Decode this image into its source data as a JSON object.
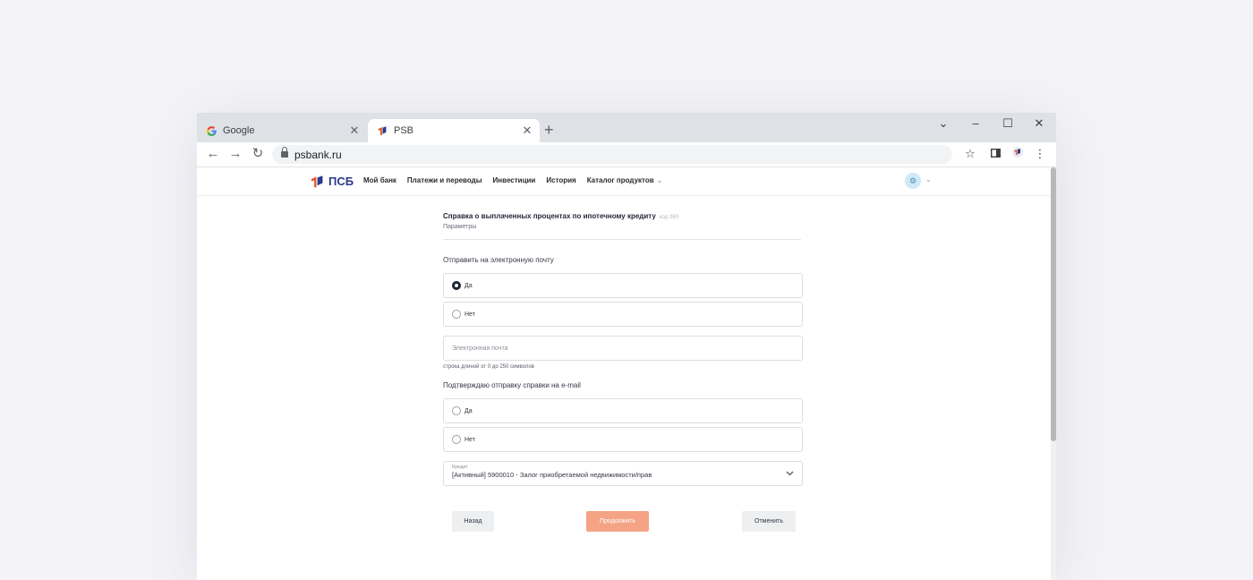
{
  "browser": {
    "tabs": [
      {
        "title": "Google",
        "icon": "google-icon",
        "active": false
      },
      {
        "title": "PSB",
        "icon": "psb-logo-icon",
        "active": true
      }
    ],
    "close_glyph": "✕",
    "new_tab_glyph": "+",
    "url": "psbank.ru",
    "window_controls": {
      "chevron": "⌄",
      "minimize": "–",
      "maximize": "☐",
      "close": "✕"
    },
    "toolbar_icons": {
      "back": "←",
      "forward": "→",
      "reload": "↻",
      "star": "☆",
      "menu": "⋮"
    }
  },
  "site": {
    "logo_text": "ПСБ",
    "nav": [
      "Мой банк",
      "Платежи и переводы",
      "Инвестиции",
      "История",
      "Каталог продуктов"
    ],
    "nav_chevron": "⌄",
    "avatar_glyph": "⚙",
    "accent_color": "#f4a485",
    "brand_color": "#2a3a8c"
  },
  "form": {
    "title": "Справка о выплаченных процентах по ипотечному кредиту",
    "code": "код 360",
    "subtitle": "Параметры",
    "send_email_label": "Отправить на электронную почту",
    "send_email_options": [
      {
        "label": "Да",
        "selected": true
      },
      {
        "label": "Нет",
        "selected": false
      }
    ],
    "email_placeholder": "Электронная почта",
    "email_hint": "строка длиной от 0 до 250 символов",
    "confirm_label": "Подтверждаю отправку справки на e-mail",
    "confirm_options": [
      {
        "label": "Да",
        "selected": false
      },
      {
        "label": "Нет",
        "selected": false
      }
    ],
    "credit_label": "Кредит",
    "credit_value": "[Активный] 5900010 - Залог приобретаемой недвижимости/прав",
    "buttons": {
      "back": "Назад",
      "continue": "Продолжить",
      "cancel": "Отменить"
    }
  }
}
